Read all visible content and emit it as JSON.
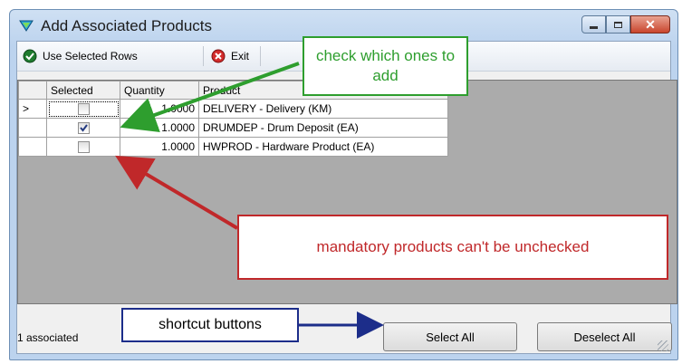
{
  "window": {
    "title": "Add Associated Products"
  },
  "toolbar": {
    "use_selected_label": "Use Selected Rows",
    "exit_label": "Exit"
  },
  "grid": {
    "columns": [
      "Selected",
      "Quantity",
      "Product"
    ],
    "rows": [
      {
        "indicator": ">",
        "selected": false,
        "quantity": "1.0000",
        "product": "DELIVERY - Delivery (KM)"
      },
      {
        "indicator": "",
        "selected": true,
        "quantity": "1.0000",
        "product": "DRUMDEP - Drum Deposit (EA)"
      },
      {
        "indicator": "",
        "selected": false,
        "quantity": "1.0000",
        "product": "HWPROD - Hardware Product (EA)"
      }
    ]
  },
  "status": {
    "text": "1 associated"
  },
  "buttons": {
    "select_all": "Select All",
    "deselect_all": "Deselect All"
  },
  "callouts": {
    "check": "check which ones to add",
    "mandatory": "mandatory products can't be unchecked",
    "shortcut": "shortcut buttons"
  },
  "colors": {
    "green": "#2e9e2e",
    "red": "#c0282a",
    "navy": "#1c2d8a"
  }
}
